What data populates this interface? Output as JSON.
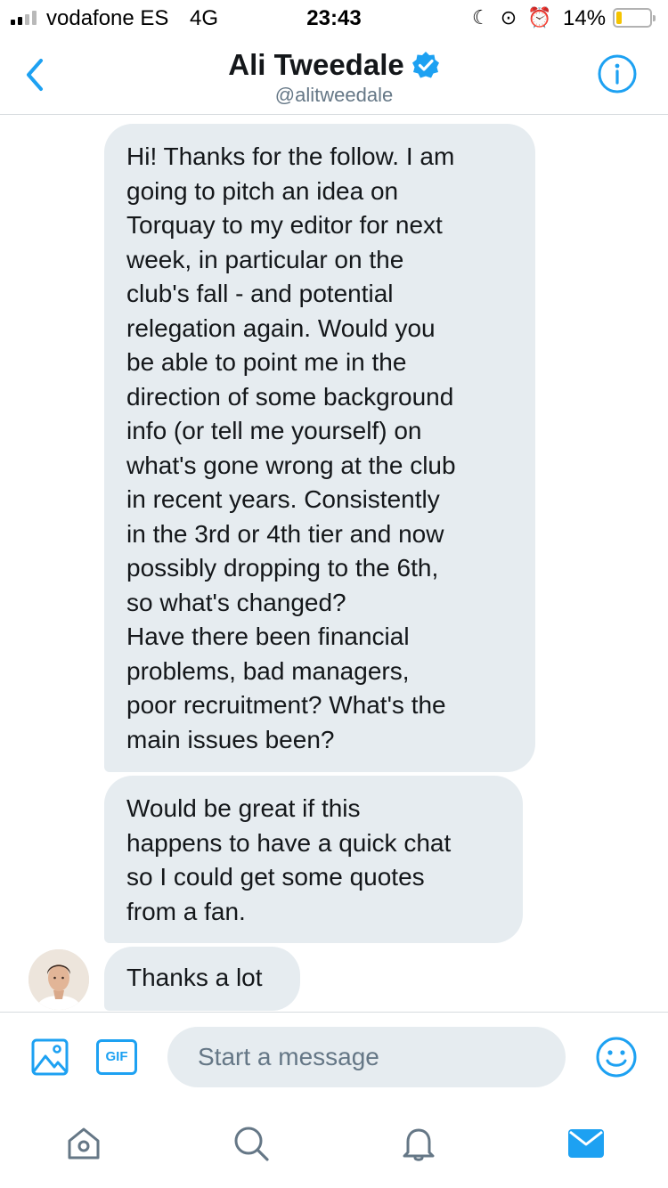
{
  "status_bar": {
    "carrier": "vodafone ES",
    "network": "4G",
    "time": "23:43",
    "battery": "14%",
    "battery_level": 0.14,
    "signal_bars": 2
  },
  "header": {
    "name": "Ali Tweedale",
    "handle": "@alitweedale",
    "verified": true,
    "back_icon": "chevron-left-icon",
    "info_icon": "info-icon"
  },
  "messages": [
    {
      "lines": [
        "Hi! Thanks for the follow. I am",
        "going to pitch an idea on",
        "Torquay to my editor for next",
        "week, in particular on the",
        "club's fall - and potential",
        "relegation again. Would you",
        "be able to point me in the",
        "direction of some background",
        "info (or tell me yourself) on",
        "what's gone wrong at the club",
        "in recent years. Consistently",
        "in the 3rd or 4th tier and now",
        "possibly dropping to the 6th,",
        "so what's changed?",
        "Have there been financial",
        "problems, bad managers,",
        "poor recruitment? What's the",
        "main issues been?"
      ]
    },
    {
      "lines": [
        "Would be great if this",
        "happens to have a quick chat",
        "so I could get some quotes",
        "from a fan."
      ]
    },
    {
      "lines": [
        "Thanks a lot"
      ]
    }
  ],
  "composer": {
    "placeholder": "Start a message",
    "media_icon": "image-icon",
    "gif_label": "GIF",
    "emoji_icon": "smiley-icon"
  },
  "tabbar": {
    "items": [
      "home-icon",
      "search-icon",
      "notifications-icon",
      "messages-icon"
    ],
    "active": "messages-icon"
  },
  "colors": {
    "accent": "#1da1f2",
    "bubble": "#e6ecf0",
    "secondary_text": "#657786"
  }
}
